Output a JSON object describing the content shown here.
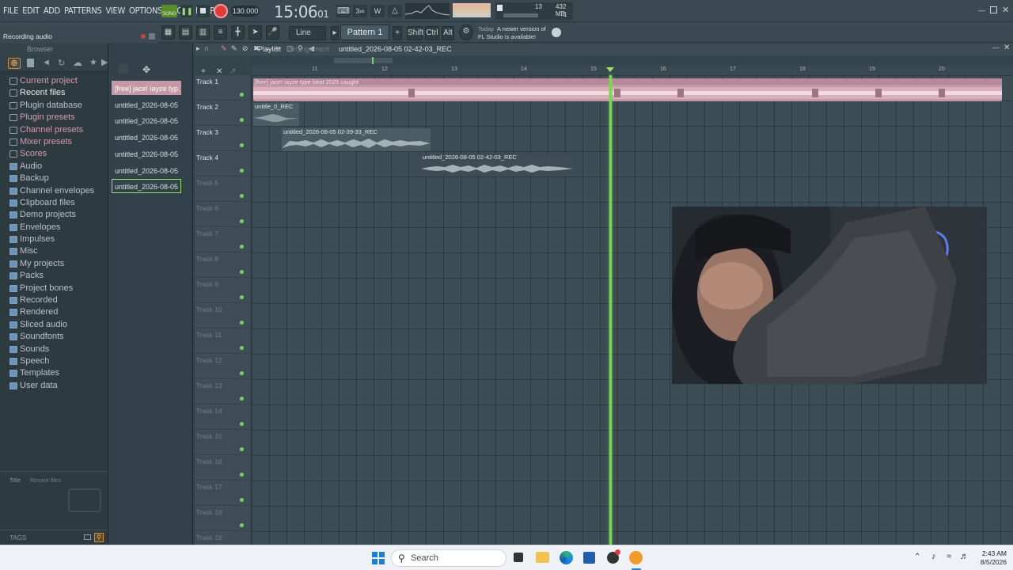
{
  "menu": [
    "FILE",
    "EDIT",
    "ADD",
    "PATTERNS",
    "VIEW",
    "OPTIONS",
    "TOOLS",
    "HELP"
  ],
  "transport": {
    "mode": "SONG",
    "tempo": "130.000",
    "time": "15:06",
    "time_sub": "01",
    "cpu": "13",
    "memory": "432 MB",
    "voices": "1"
  },
  "hint": "Recording audio",
  "toolbar2": {
    "snap": "Line",
    "pattern": "Pattern 1",
    "shift": "Shift",
    "ctrl": "Ctrl",
    "alt": "Alt",
    "news_title": "Today",
    "news_text_1": "A newer version of",
    "news_text_2": "FL Studio is available!"
  },
  "browser": {
    "title": "Browser",
    "items": [
      {
        "label": "Current project",
        "style": "pink"
      },
      {
        "label": "Recent files",
        "style": "white"
      },
      {
        "label": "Plugin database",
        "style": "plain"
      },
      {
        "label": "Plugin presets",
        "style": "pink"
      },
      {
        "label": "Channel presets",
        "style": "pink"
      },
      {
        "label": "Mixer presets",
        "style": "pink"
      },
      {
        "label": "Scores",
        "style": "pink"
      },
      {
        "label": "Audio",
        "style": "plain"
      },
      {
        "label": "Backup",
        "style": "plain"
      },
      {
        "label": "Channel envelopes",
        "style": "plain"
      },
      {
        "label": "Clipboard files",
        "style": "plain"
      },
      {
        "label": "Demo projects",
        "style": "plain"
      },
      {
        "label": "Envelopes",
        "style": "plain"
      },
      {
        "label": "Impulses",
        "style": "plain"
      },
      {
        "label": "Misc",
        "style": "plain"
      },
      {
        "label": "My projects",
        "style": "plain"
      },
      {
        "label": "Packs",
        "style": "plain"
      },
      {
        "label": "Project bones",
        "style": "plain"
      },
      {
        "label": "Recorded",
        "style": "plain"
      },
      {
        "label": "Rendered",
        "style": "plain"
      },
      {
        "label": "Sliced audio",
        "style": "plain"
      },
      {
        "label": "Soundfonts",
        "style": "plain"
      },
      {
        "label": "Sounds",
        "style": "plain"
      },
      {
        "label": "Speech",
        "style": "plain"
      },
      {
        "label": "Templates",
        "style": "plain"
      },
      {
        "label": "User data",
        "style": "plain"
      }
    ],
    "footer_col1": "Title",
    "footer_col2": "Recent files",
    "tags": "TAGS"
  },
  "picker": [
    "[free] jace! iayze typ...",
    "untitled_2026-08-05 02-...",
    "untitled_2026-08-05 02-...",
    "untitled_2026-08-05 02-...",
    "untitled_2026-08-05 02-...",
    "untitled_2026-08-05 02-...",
    "untitled_2026-08-05 02-..."
  ],
  "playlist": {
    "title": "Playlist",
    "sep": "Arrangement",
    "clip": "untitled_2026-08-05 02-42-03_REC",
    "bars": [
      "11",
      "12",
      "13",
      "14",
      "15",
      "16",
      "17",
      "18",
      "19",
      "20"
    ],
    "tracks": [
      "Track 1",
      "Track 2",
      "Track 3",
      "Track 4",
      "Track 5",
      "Track 6",
      "Track 7",
      "Track 8",
      "Track 9",
      "Track 10",
      "Track 11",
      "Track 12",
      "Track 13",
      "Track 14",
      "Track 15",
      "Track 16",
      "Track 17",
      "Track 18",
      "Track 19"
    ],
    "clips": [
      "[free] jace!  iayze type beat 2025 caught",
      "untitle_0_REC",
      "untitled_2026-08-05 02-39-33_REC",
      "untitled_2026-08-05 02-42-03_REC"
    ]
  },
  "taskbar": {
    "search": "Search",
    "time": "2:43 AM",
    "date": "8/5/2026"
  },
  "colors": {
    "accent_green": "#7fd35a",
    "record_red": "#e53a3a",
    "clip_pink": "#c89aa8",
    "clip_gray": "#4b5c64"
  }
}
